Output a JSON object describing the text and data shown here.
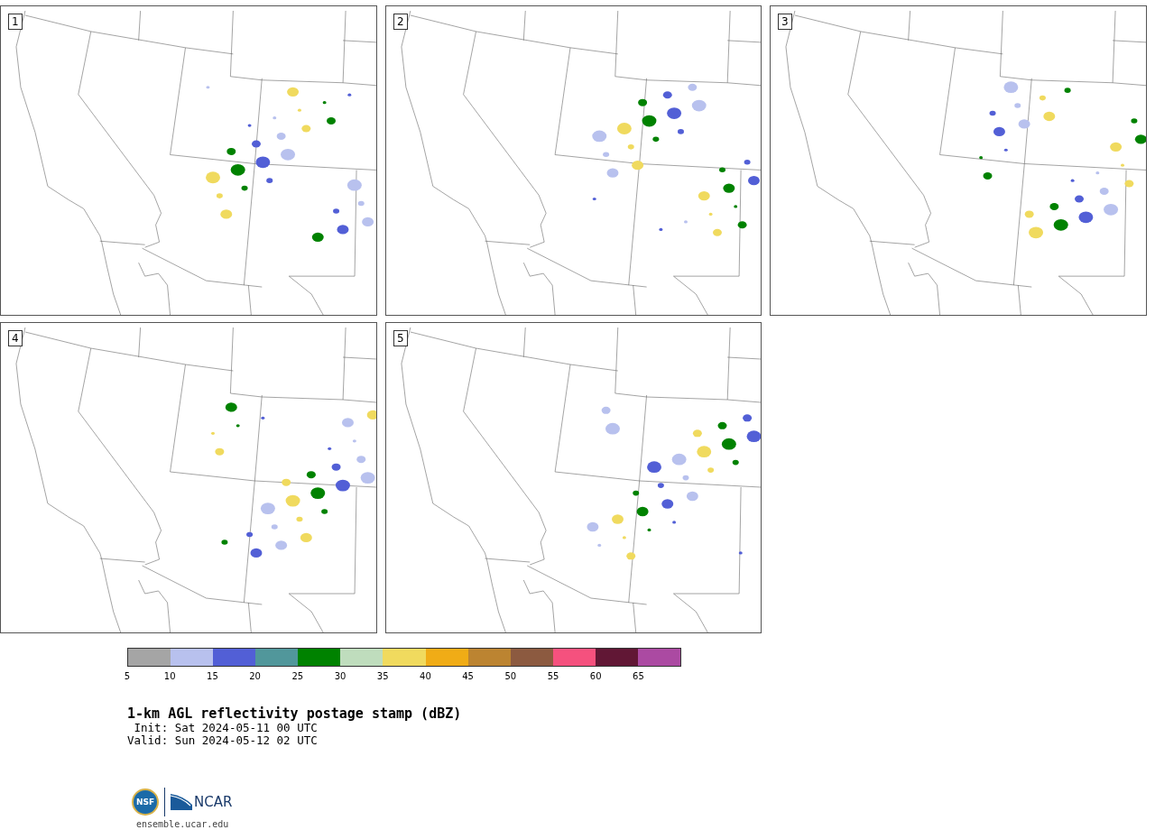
{
  "panels": [
    {
      "label": "1"
    },
    {
      "label": "2"
    },
    {
      "label": "3"
    },
    {
      "label": "4"
    },
    {
      "label": "5"
    }
  ],
  "colorbar": {
    "bins": [
      {
        "color": "#a5a5a5"
      },
      {
        "color": "#b8c1ee"
      },
      {
        "color": "#525fd6"
      },
      {
        "color": "#51979b"
      },
      {
        "color": "#008200"
      },
      {
        "color": "#bfddbd"
      },
      {
        "color": "#f0da5e"
      },
      {
        "color": "#f0ac16"
      },
      {
        "color": "#bc8431"
      },
      {
        "color": "#8c5a40"
      },
      {
        "color": "#f5517e"
      },
      {
        "color": "#611735"
      },
      {
        "color": "#ab4aa2"
      }
    ],
    "ticks": [
      "5",
      "10",
      "15",
      "20",
      "25",
      "30",
      "35",
      "40",
      "45",
      "50",
      "55",
      "60",
      "65"
    ]
  },
  "title": "1-km AGL reflectivity postage stamp (dBZ)",
  "init": " Init: Sat 2024-05-11 00 UTC",
  "valid": "Valid: Sun 2024-05-12 02 UTC",
  "logo": {
    "left": "NSF",
    "right": "NCAR"
  },
  "footer": "ensemble.ucar.edu"
}
